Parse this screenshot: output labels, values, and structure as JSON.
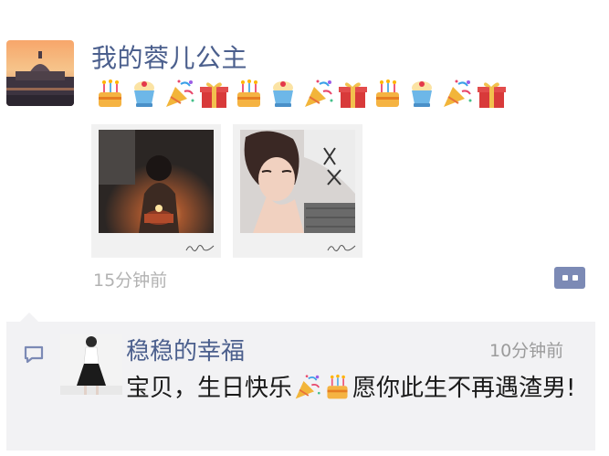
{
  "post": {
    "poster_name": "我的蓉儿公主",
    "emoji_sequence": [
      "birthday-cake",
      "pudding-dessert",
      "party-popper",
      "gift-box",
      "birthday-cake",
      "pudding-dessert",
      "party-popper",
      "gift-box",
      "birthday-cake",
      "pudding-dessert",
      "party-popper",
      "gift-box"
    ],
    "photos": [
      {
        "name": "photo-birthday-cake",
        "description_icon": "photo-thumbnail"
      },
      {
        "name": "photo-portrait",
        "description_icon": "photo-thumbnail"
      }
    ],
    "timestamp": "15分钟前",
    "more_icon": "comment-more-icon"
  },
  "comment": {
    "commenter_name": "稳稳的幸福",
    "time": "10分钟前",
    "text_before": "宝贝，生日快乐",
    "inline_emojis": [
      "party-popper",
      "birthday-cake"
    ],
    "text_after": "愿你此生不再遇渣男!"
  },
  "colors": {
    "name_blue": "#4b5f8d",
    "time_gray": "#b2b2b2",
    "panel_bg": "#f2f2f4",
    "more_button": "#7c8ab5"
  }
}
